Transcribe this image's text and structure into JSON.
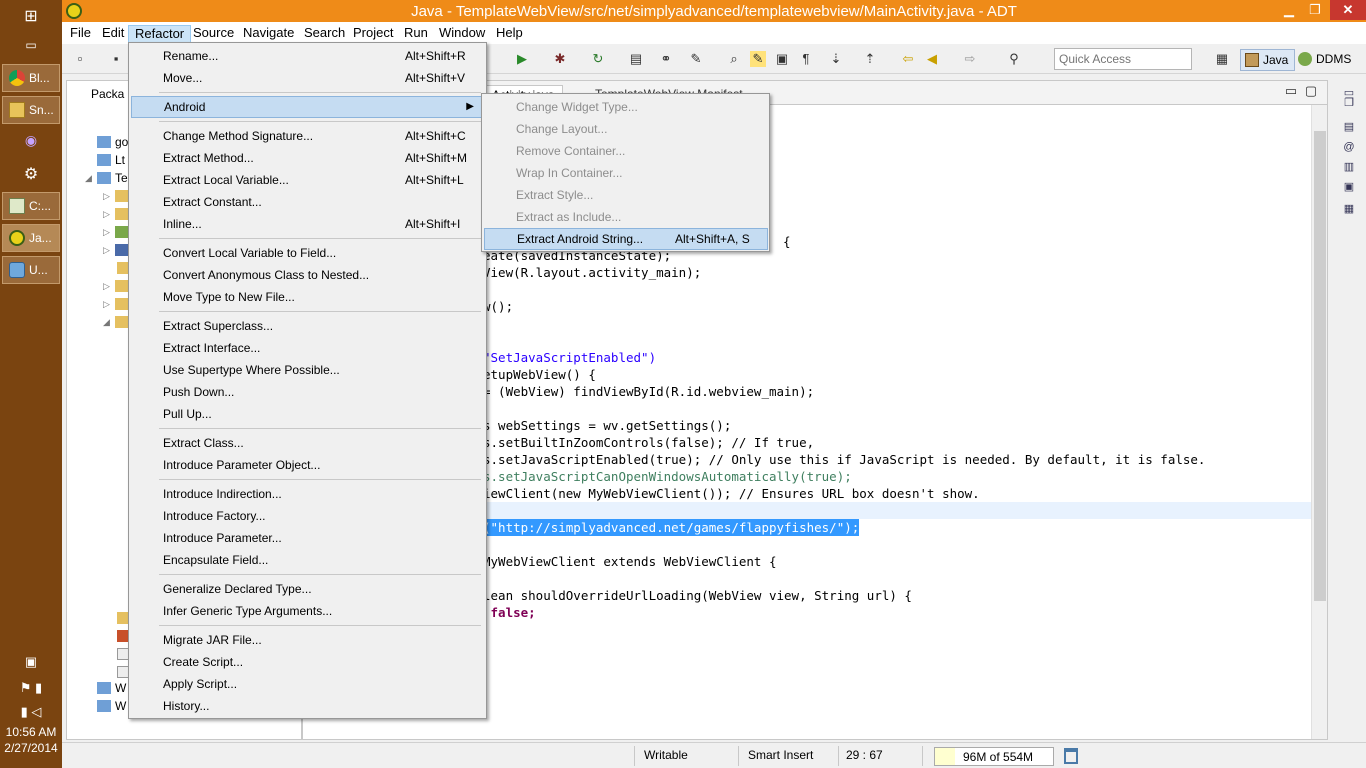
{
  "window": {
    "title": "Java - TemplateWebView/src/net/simplyadvanced/templatewebview/MainActivity.java - ADT",
    "minimize": "▁",
    "maximize": "❐",
    "close": "✕"
  },
  "taskbar": {
    "items": [
      {
        "label": "",
        "icon": "start-icon"
      },
      {
        "label": "",
        "icon": "cmd-icon"
      },
      {
        "label": "Bl...",
        "icon": "chrome-icon"
      },
      {
        "label": "Sn...",
        "icon": "folder-icon"
      },
      {
        "label": "",
        "icon": "eclipse-small-icon"
      },
      {
        "label": "",
        "icon": "gear-icon"
      },
      {
        "label": "C:...",
        "icon": "notepad-icon"
      },
      {
        "label": "Ja...",
        "icon": "adt-icon"
      },
      {
        "label": "U...",
        "icon": "paint-icon"
      }
    ],
    "clock_time": "10:56 AM",
    "clock_date": "2/27/2014"
  },
  "menubar": {
    "items": [
      "File",
      "Edit",
      "Refactor",
      "Source",
      "Navigate",
      "Search",
      "Project",
      "Run",
      "Window",
      "Help"
    ],
    "active": "Refactor"
  },
  "toolbar": {
    "quick_access_placeholder": "Quick Access",
    "perspectives": [
      {
        "label": "Java"
      },
      {
        "label": "DDMS"
      }
    ]
  },
  "package_explorer": {
    "tab_label": "Packa",
    "rows": [
      "go",
      "Lt",
      "Te",
      "",
      "",
      "",
      "",
      "",
      "",
      "",
      "",
      "W",
      "W"
    ]
  },
  "editor": {
    "tabs": [
      "Activity.java",
      "TemplateWebView Manifest"
    ],
    "code_lines": [
      {
        "text": "",
        "y": 0
      },
      {
        "text": "{"
      },
      {
        "text": "eate(savedInstanceState);"
      },
      {
        "text": "View(R.layout.activity_main);"
      },
      {
        "text": "w();"
      },
      {
        "text": "\"SetJavaScriptEnabled\")"
      },
      {
        "text": "etupWebView() {"
      },
      {
        "text": "= (WebView) findViewById(R.id.webview_main);"
      },
      {
        "text": "s webSettings = wv.getSettings();"
      },
      {
        "text": "s.setBuiltInZoomControls(false); // If true,"
      },
      {
        "text": "s.setJavaScriptEnabled(true); // Only use this if JavaScript is needed. By default, it is false."
      },
      {
        "text": "s.setJavaScriptCanOpenWindowsAutomatically(true);"
      },
      {
        "text": "iewClient(new MyWebViewClient()); // Ensures URL box doesn't show."
      },
      {
        "text": "(\"http://simplyadvanced.net/games/flappyfishes/\");"
      },
      {
        "text": "MyWebViewClient extends WebViewClient {"
      },
      {
        "text": "lean shouldOverrideUrlLoading(WebView view, String url) {"
      },
      {
        "text": " false;"
      }
    ]
  },
  "refactor_menu": {
    "items": [
      {
        "label": "Rename...",
        "accel": "Alt+Shift+R"
      },
      {
        "label": "Move...",
        "accel": "Alt+Shift+V"
      },
      {
        "label": "Android",
        "accel": "",
        "submenu": true,
        "highlighted": true
      },
      {
        "label": "Change Method Signature...",
        "accel": "Alt+Shift+C"
      },
      {
        "label": "Extract Method...",
        "accel": "Alt+Shift+M"
      },
      {
        "label": "Extract Local Variable...",
        "accel": "Alt+Shift+L"
      },
      {
        "label": "Extract Constant...",
        "accel": ""
      },
      {
        "label": "Inline...",
        "accel": "Alt+Shift+I"
      },
      {
        "label": "Convert Local Variable to Field...",
        "accel": ""
      },
      {
        "label": "Convert Anonymous Class to Nested...",
        "accel": ""
      },
      {
        "label": "Move Type to New File...",
        "accel": ""
      },
      {
        "label": "Extract Superclass...",
        "accel": ""
      },
      {
        "label": "Extract Interface...",
        "accel": ""
      },
      {
        "label": "Use Supertype Where Possible...",
        "accel": ""
      },
      {
        "label": "Push Down...",
        "accel": ""
      },
      {
        "label": "Pull Up...",
        "accel": ""
      },
      {
        "label": "Extract Class...",
        "accel": ""
      },
      {
        "label": "Introduce Parameter Object...",
        "accel": ""
      },
      {
        "label": "Introduce Indirection...",
        "accel": ""
      },
      {
        "label": "Introduce Factory...",
        "accel": ""
      },
      {
        "label": "Introduce Parameter...",
        "accel": ""
      },
      {
        "label": "Encapsulate Field...",
        "accel": ""
      },
      {
        "label": "Generalize Declared Type...",
        "accel": ""
      },
      {
        "label": "Infer Generic Type Arguments...",
        "accel": ""
      },
      {
        "label": "Migrate JAR File...",
        "accel": ""
      },
      {
        "label": "Create Script...",
        "accel": ""
      },
      {
        "label": "Apply Script...",
        "accel": ""
      },
      {
        "label": "History...",
        "accel": ""
      }
    ]
  },
  "android_submenu": {
    "items": [
      {
        "label": "Change Widget Type...",
        "accel": "",
        "disabled": true
      },
      {
        "label": "Change Layout...",
        "accel": "",
        "disabled": true
      },
      {
        "label": "Remove Container...",
        "accel": "",
        "disabled": true
      },
      {
        "label": "Wrap In Container...",
        "accel": "",
        "disabled": true
      },
      {
        "label": "Extract Style...",
        "accel": "",
        "disabled": true
      },
      {
        "label": "Extract as Include...",
        "accel": "",
        "disabled": true
      },
      {
        "label": "Extract Android String...",
        "accel": "Alt+Shift+A, S",
        "disabled": false,
        "highlighted": true
      }
    ]
  },
  "status": {
    "writable": "Writable",
    "insert_mode": "Smart Insert",
    "position": "29 : 67",
    "heap": "96M of 554M",
    "heap_used_fraction": 0.17
  },
  "colors": {
    "title_bar": "#ef8b18",
    "taskbar": "#7a4410",
    "selection": "#3399ff"
  }
}
